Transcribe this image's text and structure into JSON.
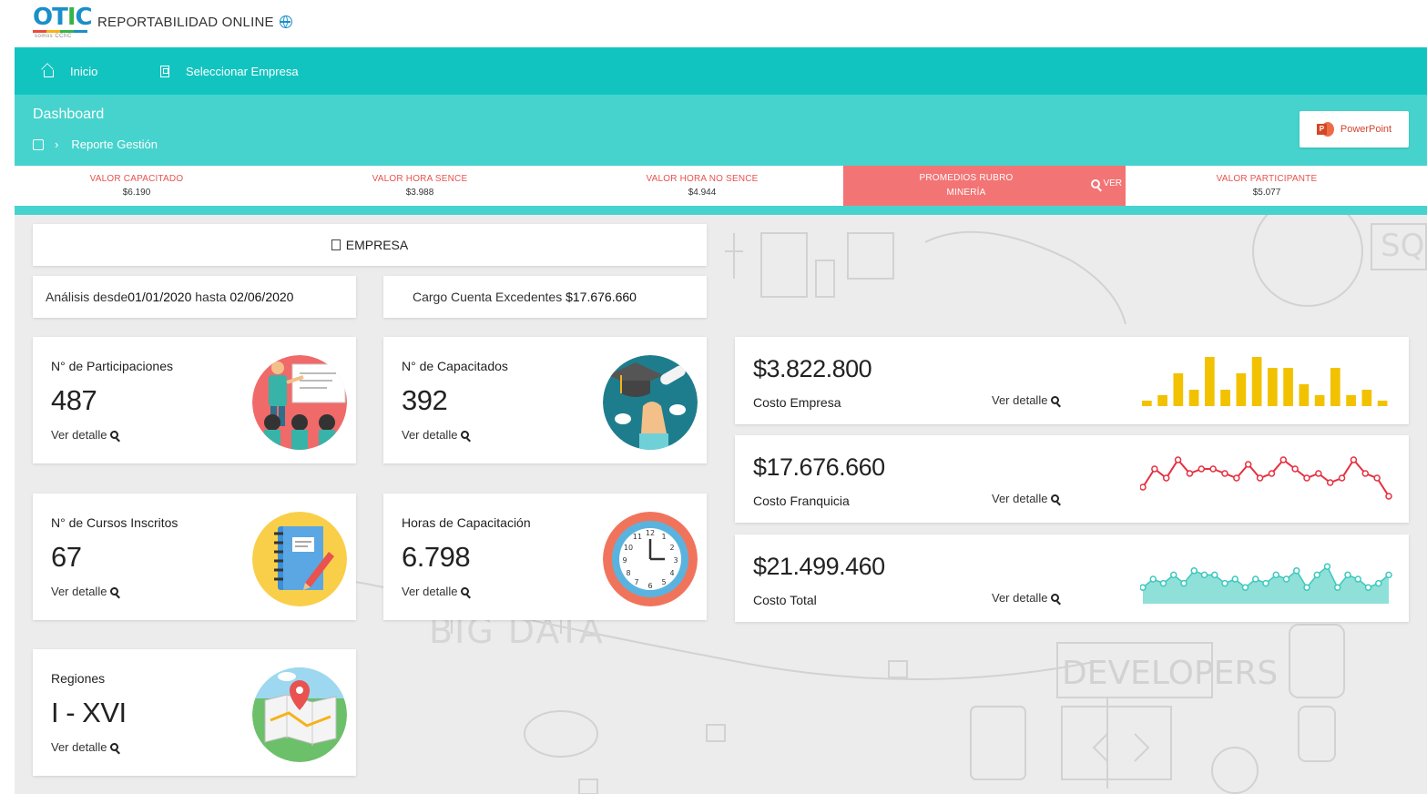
{
  "brand": {
    "logo_text": "OTIC",
    "logo_sub": "somos CChC",
    "app_title": "REPORTABILIDAD ONLINE"
  },
  "nav": {
    "items": [
      {
        "label": "Inicio",
        "icon": "home-icon"
      },
      {
        "label": "Seleccionar Empresa",
        "icon": "building-icon"
      }
    ]
  },
  "header": {
    "title": "Dashboard",
    "breadcrumb": "Reporte Gestión",
    "ppt_label": "PowerPoint"
  },
  "kpis": [
    {
      "label": "VALOR CAPACITADO",
      "value": "$6.190"
    },
    {
      "label": "VALOR HORA SENCE",
      "value": "$3.988"
    },
    {
      "label": "VALOR HORA NO SENCE",
      "value": "$4.944"
    },
    {
      "label": "PROMEDIOS RUBRO MINERÍA",
      "value": "",
      "action": "VER",
      "active_color": "#f37474"
    },
    {
      "label": "VALOR PARTICIPANTE",
      "value": "$5.077"
    }
  ],
  "empresa": {
    "label": "EMPRESA"
  },
  "info": {
    "analisis_prefix": "Análisis desde ",
    "date_from": "01/01/2020",
    "analisis_mid": " hasta ",
    "date_to": "02/06/2020",
    "cargo_prefix": "Cargo Cuenta Excedentes ",
    "cargo_value": "$17.676.660"
  },
  "stats": [
    {
      "title": "N° de Participaciones",
      "value": "487",
      "link": "Ver detalle",
      "icon": "teacher-presentation-icon"
    },
    {
      "title": "N° de Capacitados",
      "value": "392",
      "link": "Ver detalle",
      "icon": "graduation-icon"
    },
    {
      "title": "N° de Cursos Inscritos",
      "value": "67",
      "link": "Ver detalle",
      "icon": "notebook-icon"
    },
    {
      "title": "Horas de Capacitación",
      "value": "6.798",
      "link": "Ver detalle",
      "icon": "clock-icon"
    },
    {
      "title": "Regiones",
      "value": "I - XVI",
      "link": "Ver detalle",
      "icon": "map-icon"
    }
  ],
  "costs": [
    {
      "value": "$3.822.800",
      "label": "Costo Empresa",
      "link": "Ver detalle",
      "color": "#f2c200"
    },
    {
      "value": "$17.676.660",
      "label": "Costo Franquicia",
      "link": "Ver detalle",
      "color": "#e6303f"
    },
    {
      "value": "$21.499.460",
      "label": "Costo Total",
      "link": "Ver detalle",
      "color": "#3cc8bd"
    }
  ],
  "chart_data": [
    {
      "type": "bar",
      "values": [
        1,
        2,
        6,
        3,
        9,
        3,
        6,
        9,
        7,
        7,
        4,
        2,
        7,
        2,
        3,
        1
      ]
    },
    {
      "type": "line",
      "values": [
        3,
        7,
        5,
        9,
        6,
        7,
        7,
        6,
        5,
        8,
        5,
        6,
        9,
        7,
        5,
        6,
        4,
        5,
        9,
        6,
        5,
        1
      ]
    },
    {
      "type": "area",
      "values": [
        3,
        5,
        4,
        6,
        4,
        7,
        6,
        6,
        4,
        5,
        3,
        5,
        4,
        6,
        5,
        7,
        3,
        6,
        8,
        3,
        6,
        5,
        3,
        4,
        6
      ]
    }
  ]
}
